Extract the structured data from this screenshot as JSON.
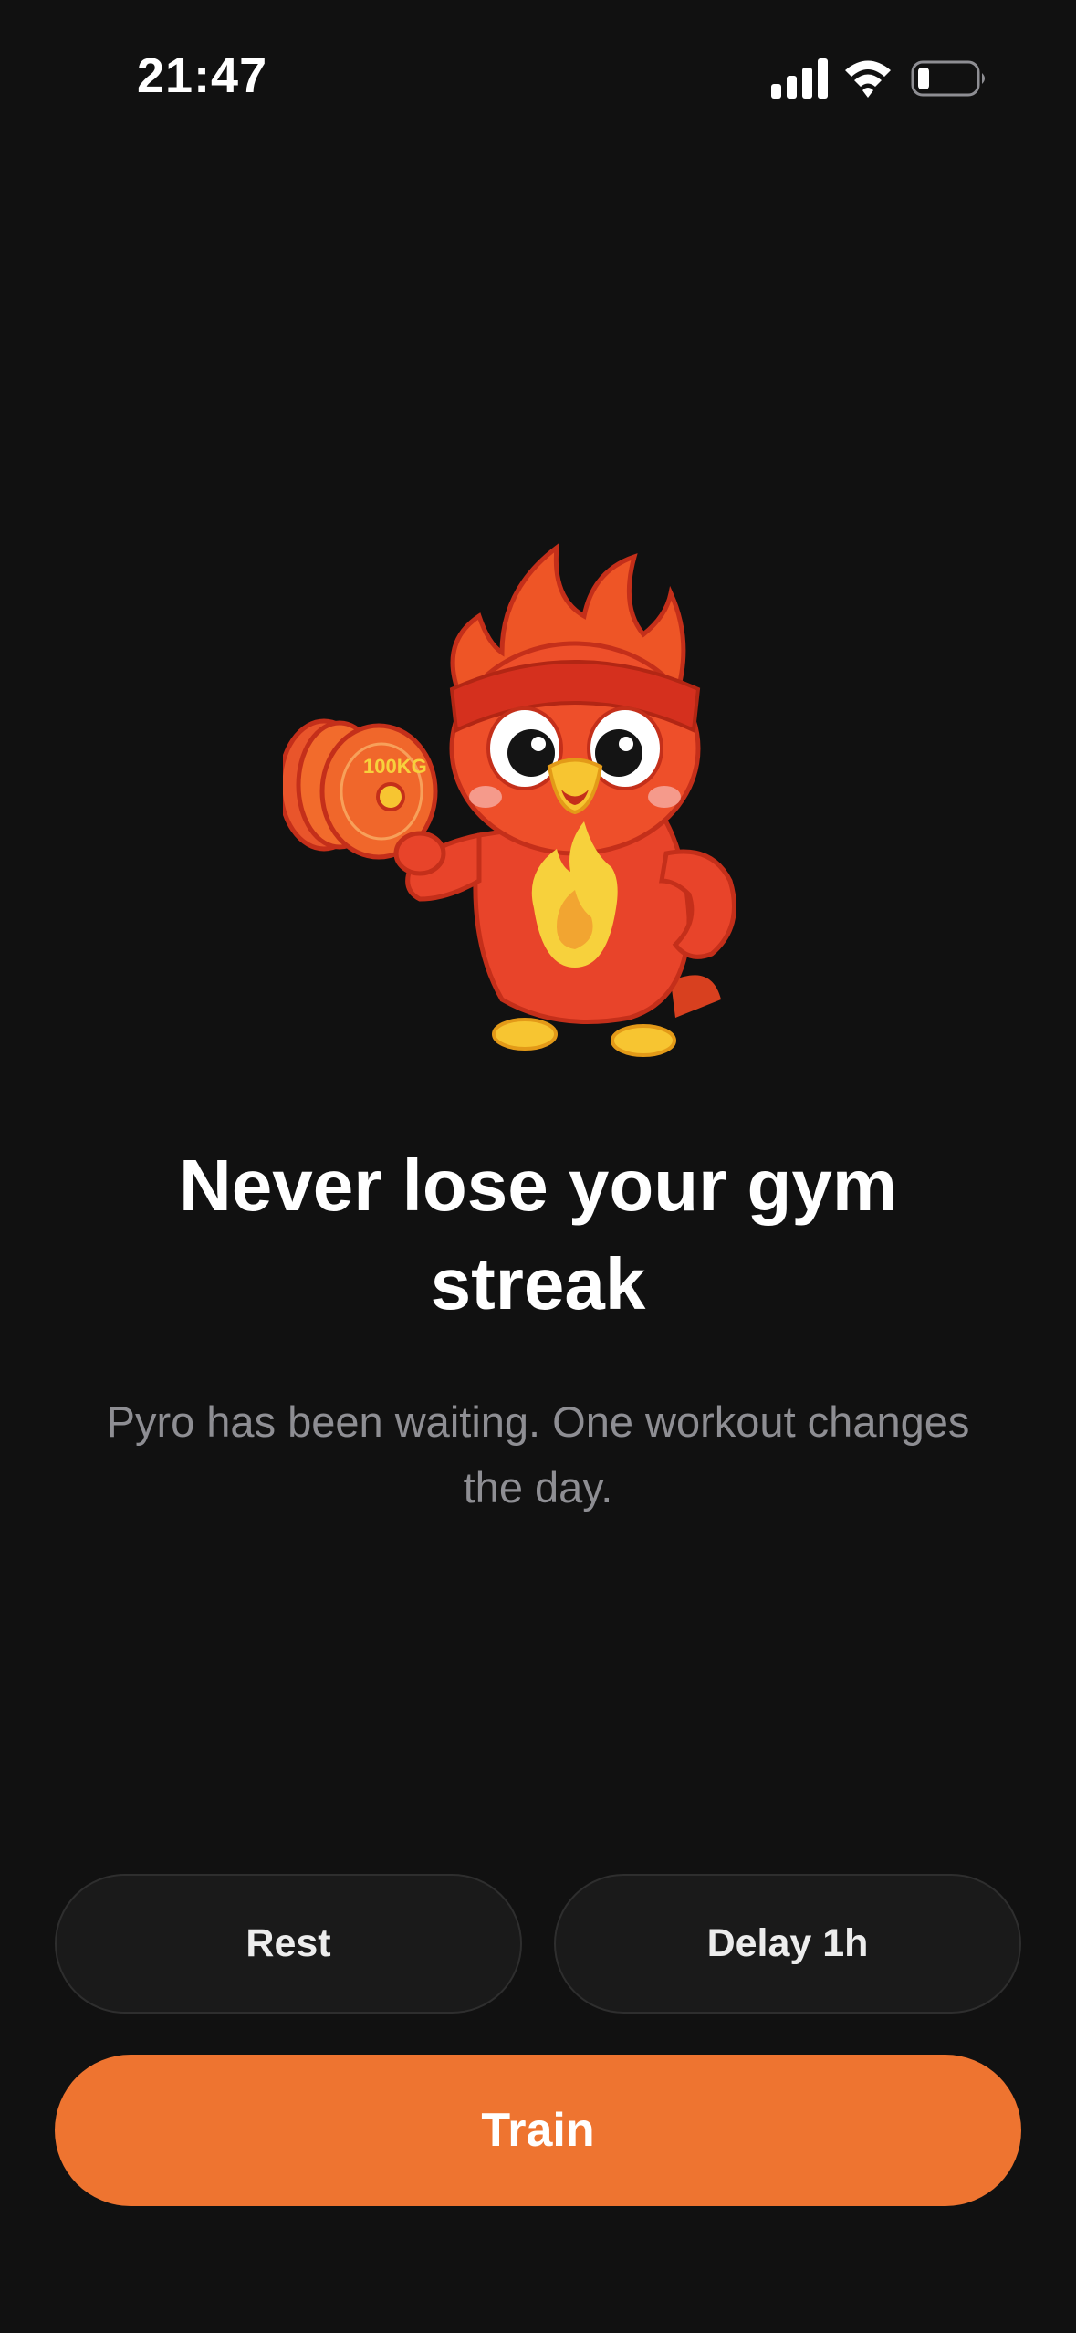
{
  "status_bar": {
    "time": "21:47",
    "signal_icon": "cellular-signal-icon",
    "wifi_icon": "wifi-icon",
    "battery_icon": "battery-low-icon"
  },
  "mascot": {
    "dumbbell_label": "100KG",
    "icon": "fire-mascot-with-dumbbell"
  },
  "headline": "Never lose your gym streak",
  "subtitle": "Pyro has been waiting. One workout changes the day.",
  "actions": {
    "rest_label": "Rest",
    "delay_label": "Delay 1h",
    "train_label": "Train"
  },
  "colors": {
    "background": "#111111",
    "accent": "#ee7430",
    "secondary_button": "#1a1a1a",
    "subtitle_text": "#8e8e93"
  }
}
